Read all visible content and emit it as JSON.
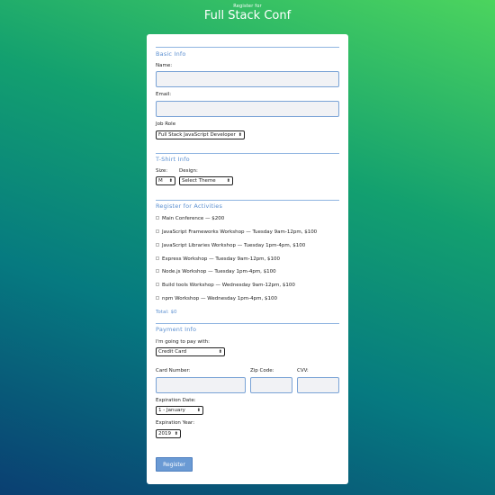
{
  "header": {
    "sup": "Register for",
    "title": "Full Stack Conf"
  },
  "basic_info": {
    "title": "Basic Info",
    "name_label": "Name:",
    "email_label": "Email:",
    "job_role_label": "Job Role",
    "job_role_value": "Full Stack JavaScript Developer"
  },
  "tshirt": {
    "title": "T-Shirt Info",
    "size_label": "Size:",
    "size_value": "M",
    "design_label": "Design:",
    "design_value": "Select Theme"
  },
  "activities": {
    "title": "Register for Activities",
    "items": [
      "Main Conference — $200",
      "JavaScript Frameworks Workshop — Tuesday 9am-12pm, $100",
      "JavaScript Libraries Workshop — Tuesday 1pm-4pm, $100",
      "Express Workshop — Tuesday 9am-12pm, $100",
      "Node.js Workshop — Tuesday 1pm-4pm, $100",
      "Build tools Workshop — Wednesday 9am-12pm, $100",
      "npm Workshop — Wednesday 1pm-4pm, $100"
    ],
    "total": "Total: $0"
  },
  "payment": {
    "title": "Payment Info",
    "pay_label": "I'm going to pay with:",
    "pay_value": "Credit Card",
    "card_label": "Card Number:",
    "zip_label": "Zip Code:",
    "cvv_label": "CVV:",
    "exp_date_label": "Expiration Date:",
    "exp_date_value": "1 - January",
    "exp_year_label": "Expiration Year:",
    "exp_year_value": "2019"
  },
  "register_button": "Register",
  "colors": {
    "accent": "#5b8fd0",
    "button": "#6a9ad4"
  }
}
